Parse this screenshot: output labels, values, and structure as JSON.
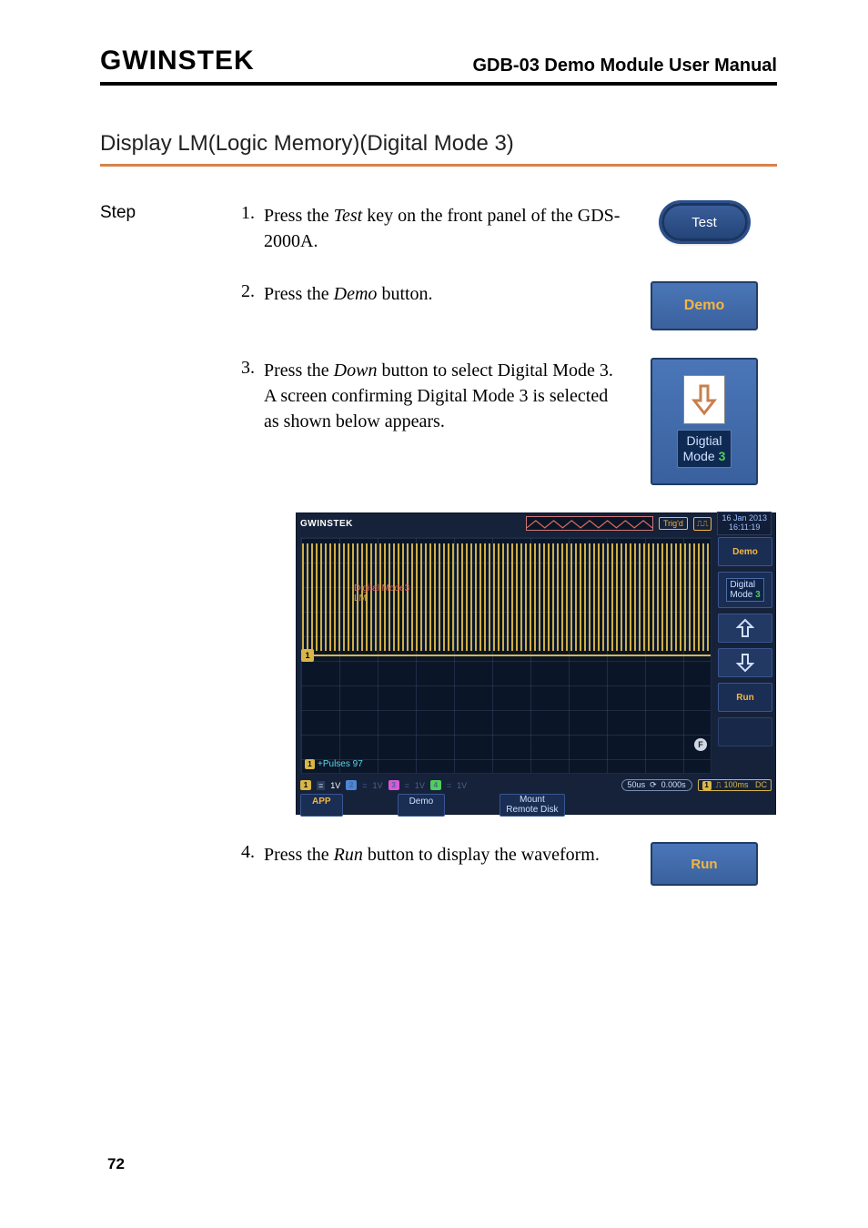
{
  "header": {
    "brand": "GWINSTEK",
    "doc_title": "GDB-03 Demo Module User Manual"
  },
  "section_title": "Display LM(Logic Memory)(Digital Mode 3)",
  "steps_label": "Step",
  "steps": [
    {
      "num": "1.",
      "text_pre": "Press the ",
      "em": "Test",
      "text_post": " key on the front panel of the GDS-2000A."
    },
    {
      "num": "2.",
      "text_pre": "Press the ",
      "em": "Demo",
      "text_post": " button."
    },
    {
      "num": "3.",
      "text_pre": "Press the ",
      "em": "Down",
      "text_post": " button to select Digital Mode 3. A screen confirming Digital Mode 3 is selected as shown below appears."
    },
    {
      "num": "4.",
      "text_pre": "Press the ",
      "em": "Run",
      "text_post": " button to display the waveform."
    }
  ],
  "buttons": {
    "test": "Test",
    "demo": "Demo",
    "digital": "Digtial",
    "mode_prefix": "Mode ",
    "mode_num": "3",
    "run": "Run"
  },
  "scope": {
    "brand": "GWINSTEK",
    "trig": "Trig'd",
    "timestamp_date": "16 Jan 2013",
    "timestamp_time": "16:11:19",
    "side": {
      "demo": "Demo",
      "digital": "Digital",
      "mode_prefix": "Mode ",
      "mode_num": "3",
      "run": "Run"
    },
    "waveform_label_red": "Digital Mode3",
    "waveform_label": "LM",
    "pulses_label": "+Pulses 97",
    "ch1_marker": "1",
    "f_marker": "F",
    "info": {
      "ch1": "1V",
      "ch2": "1V",
      "ch3": "1V",
      "ch4": "1V",
      "timebase": "50us",
      "delay": "0.000s",
      "trig_src": "1",
      "trig_level": "100ms",
      "coupling": "DC"
    },
    "bottom_buttons": {
      "app": "APP",
      "demo": "Demo",
      "mount1": "Mount",
      "mount2": "Remote Disk"
    }
  },
  "page_number": "72"
}
